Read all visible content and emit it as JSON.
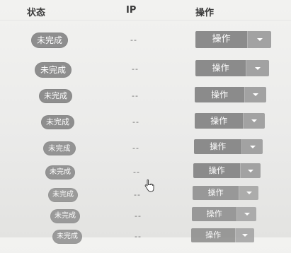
{
  "table": {
    "headers": {
      "status": "状态",
      "ip": "IP",
      "operation": "操作"
    },
    "rows": [
      {
        "status": "未完成",
        "ip": "--",
        "operation": "操作"
      },
      {
        "status": "未完成",
        "ip": "--",
        "operation": "操作"
      },
      {
        "status": "未完成",
        "ip": "--",
        "operation": "操作"
      },
      {
        "status": "未完成",
        "ip": "--",
        "operation": "操作"
      },
      {
        "status": "未完成",
        "ip": "--",
        "operation": "操作"
      },
      {
        "status": "未完成",
        "ip": "--",
        "operation": "操作"
      },
      {
        "status": "未完成",
        "ip": "--",
        "operation": "操作"
      },
      {
        "status": "未完成",
        "ip": "--",
        "operation": "操作"
      },
      {
        "status": "未完成",
        "ip": "--",
        "operation": "操作"
      }
    ]
  },
  "colors": {
    "badge_bg": "#8e8e8e",
    "button_bg": "#8b8b8b",
    "caret_bg": "#a2a2a2",
    "page_bg": "#eeeeec"
  },
  "icons": {
    "dropdown": "chevron-down-icon",
    "cursor": "hand-pointer-icon"
  }
}
